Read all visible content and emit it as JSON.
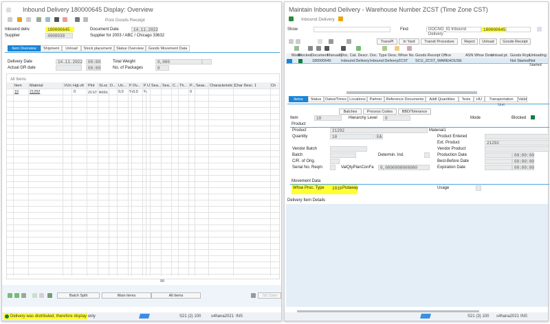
{
  "left": {
    "title": "Inbound Delivery 180000645 Display: Overview",
    "toolbar": {
      "post_gr": "Post Goods Receipt"
    },
    "header": {
      "inbound_label": "Inbound deliv.",
      "inbound_value": "180000645",
      "supplier_label": "Supplier",
      "supplier_value": "4000030",
      "doc_date_label": "Document Date",
      "doc_date_value": "14.11.2022",
      "supplier_desc": "Supplier for 2003 / ABC / Chicago 33632"
    },
    "tabs": [
      "Item Overview",
      "Shipment",
      "Unload",
      "Stock placement",
      "Status Overview",
      "Goods Movement Data"
    ],
    "overview": {
      "delivery_date_label": "Delivery Date",
      "delivery_date": "14.11.2022",
      "delivery_time": "00:00",
      "actual_gr_label": "Actual GR date",
      "actual_gr_time": "00:00",
      "total_weight_label": "Total Weight",
      "total_weight": "0,000",
      "packages_label": "No. of Packages",
      "packages": "0"
    },
    "table": {
      "title": "All Items",
      "columns": [
        "Item",
        "Material",
        "VUn",
        "HgLvIt",
        "Plnt",
        "SLoc",
        "D...",
        "Un...",
        "P",
        "Ov...",
        "P",
        "U",
        "Sea...",
        "Sea...",
        "C...",
        "Th...",
        "P...",
        "Seas...",
        "Characteristic 1",
        "Char Desc. 1",
        "Ch"
      ],
      "rows": [
        {
          "item": "10",
          "material": "21292",
          "hglvit": "0",
          "plnt": "ZCST",
          "sloc": "ROD1",
          "un": "0,0",
          "p": "%",
          "ov": "0,0",
          "p2": "%",
          "p3": "0"
        }
      ]
    },
    "buttons": {
      "batch_split": "Batch Split",
      "main_items": "Main items",
      "all_items": "All items",
      "sc_comp": "SC Com"
    },
    "status": {
      "message": "Delivery was distributed, therefore display only",
      "system": "S21 (2) 100",
      "server": "s4hana2021",
      "mode": "INS"
    }
  },
  "right": {
    "title": "Maintain Inbound Delivery - Warehouse Number ZCST (Time Zone CST)",
    "subtitle": "Inbound Delivery",
    "show_label": "Show",
    "show_value": "",
    "find_label": "Find",
    "find_field": "DOCNO_ID Inbound Delivery",
    "find_value": "180000645",
    "toolbar": {
      "transpl": "TransPl",
      "in_yard": "In Yard",
      "transit": "Transit Procedure",
      "reject": "Reject",
      "unload": "Unload",
      "goods_receipt": "Goods Receipt"
    },
    "table": {
      "columns": [
        "Mode",
        "Blocked",
        "Document",
        "Manually",
        "Doc. Cat. Descr.",
        "Doc. Type Desc.",
        "Whse No.",
        "Goods Receipt Office",
        "ASN",
        "Whse Door",
        "Unload.pt.",
        "Goods Rcpt",
        "Unloading"
      ],
      "rows": [
        {
          "document": "180000645",
          "cat": "Inbound Delivery",
          "type": "Inbound Delivery",
          "whse": "ZCST",
          "office": "SCU_ZCST_WAREHOUSE",
          "gr": "Not Started",
          "unloading": "Not Started"
        }
      ]
    },
    "tabs": [
      "Items",
      "Status",
      "Dates/Times",
      "Locations",
      "Partner",
      "Reference Documents",
      "Addl Quantities",
      "Texts",
      "HU",
      "Transportation Unit",
      "Valid"
    ],
    "item_toolbar": {
      "batches": "Batches",
      "process_codes": "Process Codes",
      "bbd": "BBD/Tolerance"
    },
    "item": {
      "item_label": "Item",
      "item_value": "10",
      "hier_label": "Hierarchy Level",
      "hier_value": "0",
      "mode_label": "Mode",
      "blocked_label": "Blocked",
      "product_section": "Product",
      "product_label": "Product",
      "product_value": "21292",
      "product_desc": "Material1",
      "quantity_label": "Quantity",
      "quantity_value": "10",
      "uom": "EA",
      "product_entered_label": "Product Entered",
      "ext_product_label": "Ext. Product",
      "ext_product_value": "21292",
      "vendor_batch_label": "Vendor Batch",
      "vendor_product_label": "Vendor Product",
      "batch_label": "Batch",
      "determ_label": "Determin. Ind.",
      "production_date_label": "Production Date",
      "production_time": "00:00:00",
      "coo_label": "C/R. of Orig.",
      "bbd_label": "Best-Before Date",
      "bbd_time": "00:00:00",
      "serial_label": "Serial No. Reqm",
      "valqty_label": "ValQtyPlanConFa",
      "valqty_value": "0,0000000000000",
      "expiration_label": "Expiration Date",
      "expiration_time": "00:00:00",
      "movement_section": "Movement Data",
      "whse_proc_label": "Whse Proc. Type",
      "whse_proc_value": "1010",
      "whse_proc_desc": "Putaway",
      "usage_label": "Usage"
    },
    "details_label": "Delivery Item Details",
    "status": {
      "system": "S21 (3) 100",
      "server": "s4hana2021",
      "mode": "INS"
    }
  },
  "colors": {
    "highlight": "#ffff33",
    "accent": "#1a85d6",
    "orange": "#f0a30a",
    "green": "#107e3e"
  }
}
